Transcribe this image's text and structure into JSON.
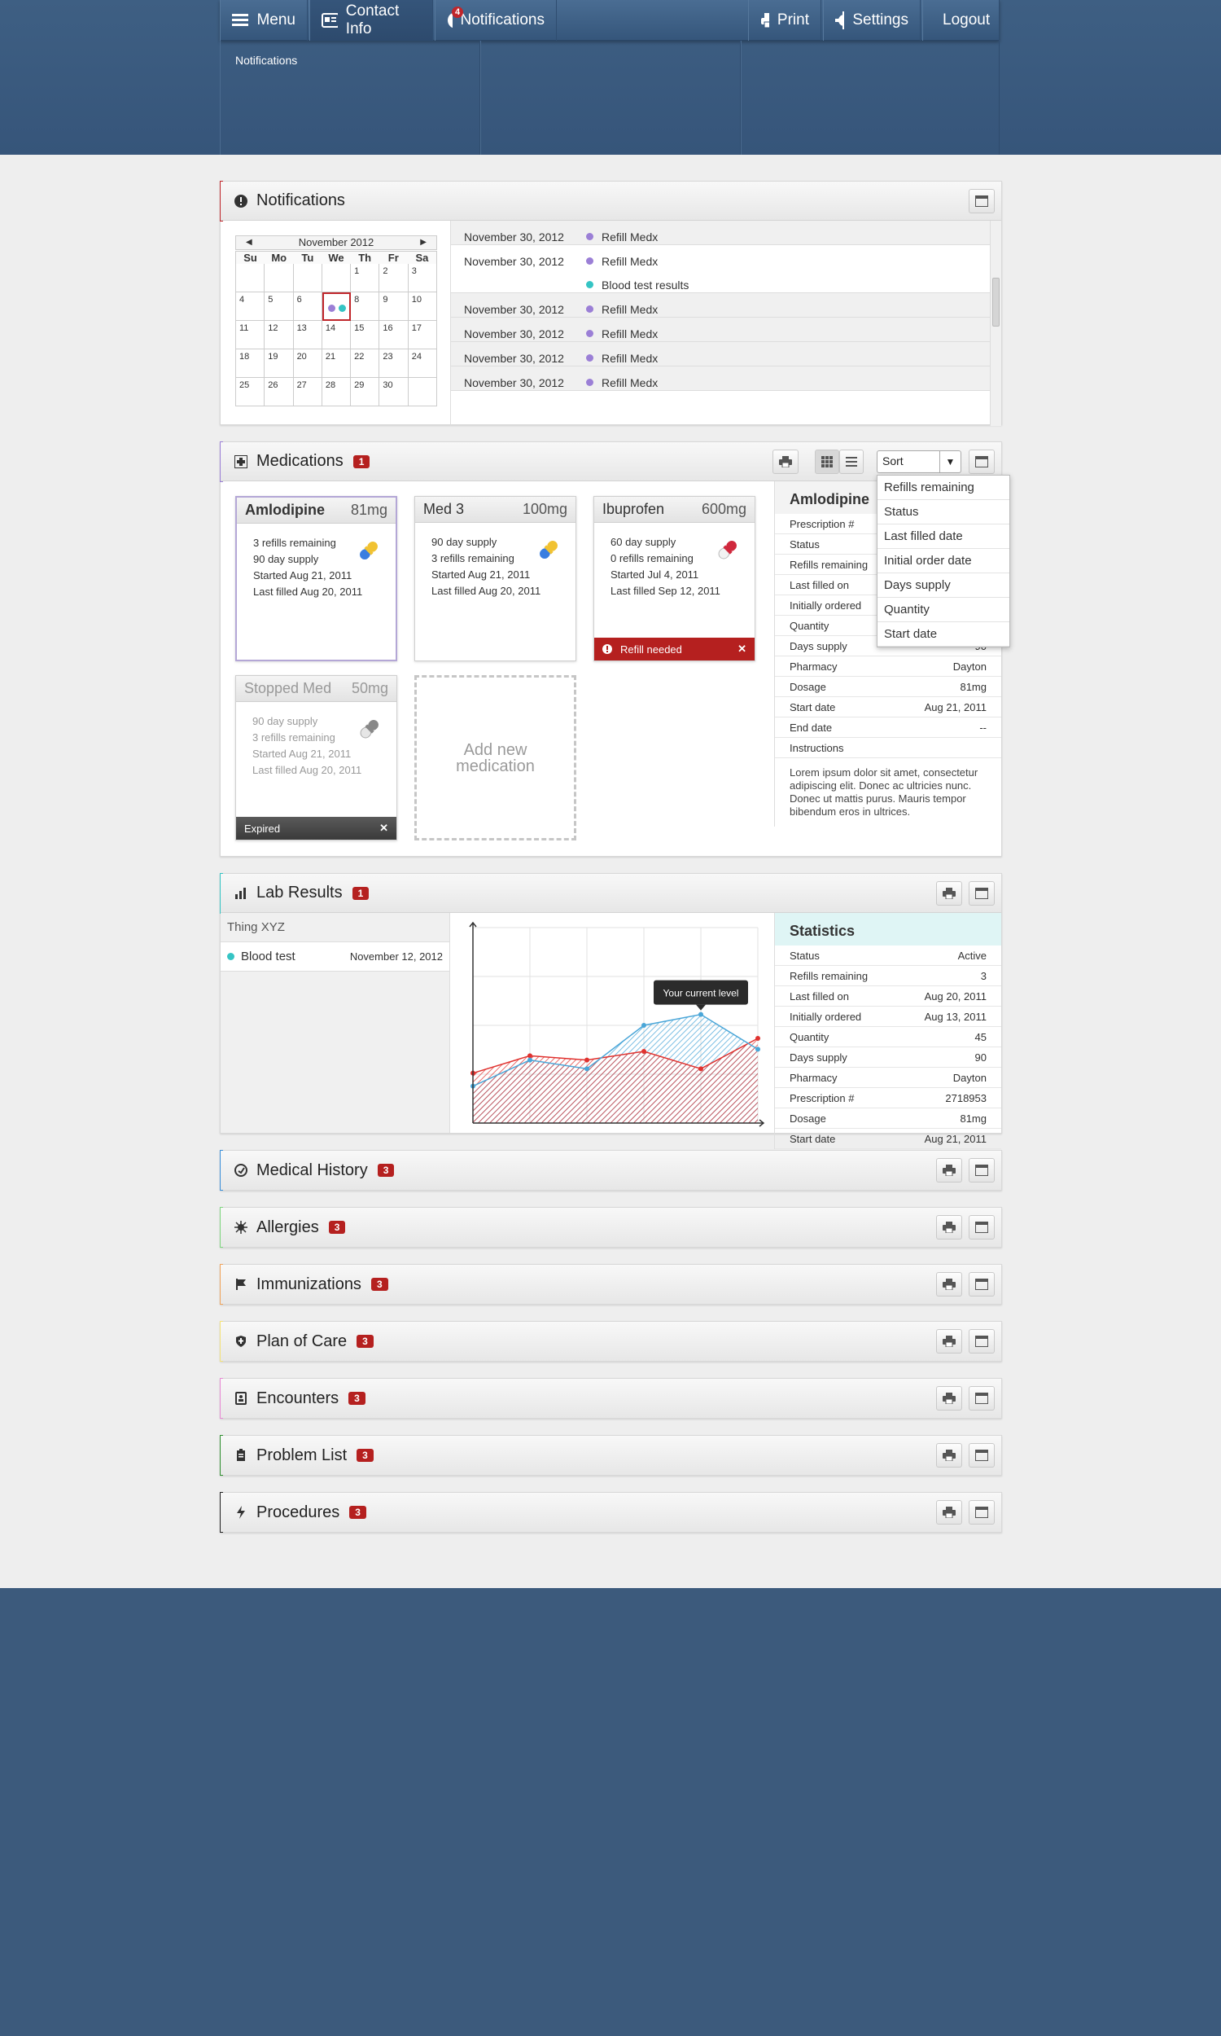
{
  "nav": {
    "menu": "Menu",
    "contact": "Contact Info",
    "notifications": "Notifications",
    "notif_count": "4",
    "print": "Print",
    "settings": "Settings",
    "logout": "Logout"
  },
  "subnav": {
    "item": "Notifications"
  },
  "notifications": {
    "title": "Notifications",
    "calendar": {
      "month": "November 2012",
      "days": [
        "Su",
        "Mo",
        "Tu",
        "We",
        "Th",
        "Fr",
        "Sa"
      ],
      "cells": [
        "",
        "",
        "",
        "",
        "1",
        "2",
        "3",
        "4",
        "5",
        "6",
        "",
        "8",
        "9",
        "10",
        "11",
        "12",
        "13",
        "14",
        "15",
        "16",
        "17",
        "18",
        "19",
        "20",
        "21",
        "22",
        "23",
        "24",
        "25",
        "26",
        "27",
        "28",
        "29",
        "30",
        ""
      ]
    },
    "rows": [
      {
        "date": "November 30, 2012",
        "items": [
          "Refill Medx"
        ]
      },
      {
        "date": "November 30, 2012",
        "items": [
          "Refill Medx",
          "Blood test results"
        ]
      },
      {
        "date": "November 30, 2012",
        "items": [
          "Refill Medx"
        ]
      },
      {
        "date": "November 30, 2012",
        "items": [
          "Refill Medx"
        ]
      },
      {
        "date": "November 30, 2012",
        "items": [
          "Refill Medx"
        ]
      },
      {
        "date": "November 30, 2012",
        "items": [
          "Refill Medx"
        ]
      }
    ]
  },
  "medications": {
    "title": "Medications",
    "count": "1",
    "sort": "Sort",
    "sort_options": [
      "Refills remaining",
      "Status",
      "Last filled date",
      "Initial order date",
      "Days supply",
      "Quantity",
      "Start date"
    ],
    "cards": [
      {
        "name": "Amlodipine",
        "dose": "81mg",
        "lines": [
          "3 refills remaining",
          "90 day supply",
          "Started Aug 21, 2011",
          "Last filled Aug 20, 2011"
        ]
      },
      {
        "name": "Med 3",
        "dose": "100mg",
        "lines": [
          "90 day supply",
          "3 refills remaining",
          "Started Aug 21, 2011",
          "Last filled Aug 20, 2011"
        ]
      },
      {
        "name": "Ibuprofen",
        "dose": "600mg",
        "lines": [
          "60 day supply",
          "0 refills remaining",
          "Started Jul 4, 2011",
          "Last filled Sep 12, 2011"
        ],
        "footer": "Refill needed"
      },
      {
        "name": "Stopped Med",
        "dose": "50mg",
        "lines": [
          "90 day supply",
          "3 refills remaining",
          "Started Aug 21, 2011",
          "Last filled Aug 20, 2011"
        ],
        "footer": "Expired"
      }
    ],
    "add_new": "Add new medication",
    "detail": {
      "title": "Amlodipine",
      "rows": [
        {
          "label": "Prescription #",
          "value": ""
        },
        {
          "label": "Status",
          "value": ""
        },
        {
          "label": "Refills remaining",
          "value": ""
        },
        {
          "label": "Last filled on",
          "value": ""
        },
        {
          "label": "Initially ordered",
          "value": ""
        },
        {
          "label": "Quantity",
          "value": ""
        },
        {
          "label": "Days supply",
          "value": "90"
        },
        {
          "label": "Pharmacy",
          "value": "Dayton"
        },
        {
          "label": "Dosage",
          "value": "81mg"
        },
        {
          "label": "Start date",
          "value": "Aug 21, 2011"
        },
        {
          "label": "End date",
          "value": "--"
        },
        {
          "label": "Instructions",
          "value": ""
        }
      ],
      "instructions": "Lorem ipsum dolor sit amet, consectetur adipiscing elit. Donec ac ultricies nunc. Donec ut mattis purus. Mauris tempor bibendum eros in ultrices."
    }
  },
  "lab": {
    "title": "Lab Results",
    "count": "1",
    "group": "Thing XYZ",
    "test": "Blood test",
    "test_date": "November 12, 2012",
    "tooltip": "Your current level",
    "stats_title": "Statistics",
    "stats": [
      {
        "label": "Status",
        "value": "Active"
      },
      {
        "label": "Refills remaining",
        "value": "3"
      },
      {
        "label": "Last filled on",
        "value": "Aug 20, 2011"
      },
      {
        "label": "Initially ordered",
        "value": "Aug 13, 2011"
      },
      {
        "label": "Quantity",
        "value": "45"
      },
      {
        "label": "Days supply",
        "value": "90"
      },
      {
        "label": "Pharmacy",
        "value": "Dayton"
      },
      {
        "label": "Prescription #",
        "value": "2718953"
      },
      {
        "label": "Dosage",
        "value": "81mg"
      },
      {
        "label": "Start date",
        "value": "Aug 21, 2011"
      }
    ]
  },
  "chart_data": {
    "type": "area",
    "x": [
      1,
      2,
      3,
      4,
      5,
      6
    ],
    "series": [
      {
        "name": "",
        "color": "#e0322f",
        "values": [
          23,
          31,
          29,
          33,
          25,
          39
        ]
      },
      {
        "name": "",
        "color": "#4aa6d8",
        "values": [
          17,
          29,
          25,
          45,
          50,
          34
        ]
      }
    ],
    "ylim": [
      0,
      90
    ],
    "annotation": "Your current level"
  },
  "sections": [
    {
      "title": "Medical History",
      "count": "3",
      "color": "#3a8fd9"
    },
    {
      "title": "Allergies",
      "count": "3",
      "color": "#7fd67f"
    },
    {
      "title": "Immunizations",
      "count": "3",
      "color": "#f0a35a"
    },
    {
      "title": "Plan of Care",
      "count": "3",
      "color": "#f4e27a"
    },
    {
      "title": "Encounters",
      "count": "3",
      "color": "#e88ad4"
    },
    {
      "title": "Problem List",
      "count": "3",
      "color": "#2f8f2f"
    },
    {
      "title": "Procedures",
      "count": "3",
      "color": "#222222"
    }
  ],
  "colors": {
    "accent_red": "#b5201f",
    "notif_purple": "#9b7fd6",
    "notif_teal": "#35c4c4"
  }
}
